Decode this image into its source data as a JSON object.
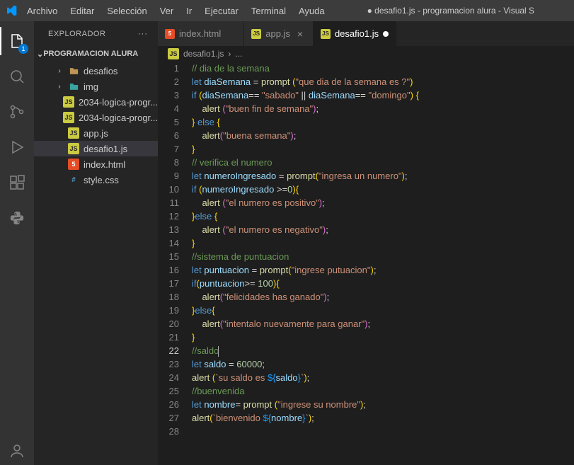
{
  "menu": {
    "archivo": "Archivo",
    "editar": "Editar",
    "seleccion": "Selección",
    "ver": "Ver",
    "ir": "Ir",
    "ejecutar": "Ejecutar",
    "terminal": "Terminal",
    "ayuda": "Ayuda"
  },
  "windowTitle": "● desafio1.js - programacion alura - Visual S",
  "explorer": {
    "label": "EXPLORADOR",
    "section": "PROGRAMACION ALURA"
  },
  "tree": [
    {
      "name": "desafios",
      "icon": "folder",
      "chev": ">"
    },
    {
      "name": "img",
      "icon": "imgfolder",
      "chev": ">"
    },
    {
      "name": "2034-logica-progr...",
      "icon": "js"
    },
    {
      "name": "2034-logica-progr...",
      "icon": "js"
    },
    {
      "name": "app.js",
      "icon": "js"
    },
    {
      "name": "desafio1.js",
      "icon": "js",
      "selected": true
    },
    {
      "name": "index.html",
      "icon": "html"
    },
    {
      "name": "style.css",
      "icon": "css"
    }
  ],
  "tabs": [
    {
      "label": "index.html",
      "icon": "html"
    },
    {
      "label": "app.js",
      "icon": "js",
      "close": true
    },
    {
      "label": "desafio1.js",
      "icon": "js",
      "active": true,
      "dirty": true
    }
  ],
  "breadcrumb": {
    "file": "desafio1.js",
    "rest": "..."
  },
  "code": [
    {
      "n": 1,
      "t": "comment",
      "s": "// dia de la semana"
    },
    {
      "n": 2,
      "s": "<span class='tk-kw'>let</span> <span class='tk-var'>diaSemana</span> = <span class='tk-fn'>prompt</span> <span class='tk-brace-y'>(</span><span class='tk-str'>\"que dia de la semana es ?\"</span><span class='tk-brace-y'>)</span>"
    },
    {
      "n": 3,
      "s": "<span class='tk-kw'>if</span> <span class='tk-brace-y'>(</span><span class='tk-var'>diaSemana</span>== <span class='tk-str'>\"sabado\"</span> || <span class='tk-var'>diaSemana</span>== <span class='tk-str'>\"domingo\"</span><span class='tk-brace-y'>)</span> <span class='tk-brace-y'>{</span>"
    },
    {
      "n": 4,
      "s": "    <span class='tk-fn'>alert</span> <span class='tk-brace-p'>(</span><span class='tk-str'>\"buen fin de semana\"</span><span class='tk-brace-p'>)</span>;"
    },
    {
      "n": 5,
      "s": "<span class='tk-brace-y'>}</span> <span class='tk-kw'>else</span> <span class='tk-brace-y'>{</span>"
    },
    {
      "n": 6,
      "s": "    <span class='tk-fn'>alert</span><span class='tk-brace-p'>(</span><span class='tk-str'>\"buena semana\"</span><span class='tk-brace-p'>)</span>;"
    },
    {
      "n": 7,
      "s": "<span class='tk-brace-y'>}</span>"
    },
    {
      "n": 8,
      "t": "comment",
      "s": "// verifica el numero"
    },
    {
      "n": 9,
      "s": "<span class='tk-kw'>let</span> <span class='tk-var'>numeroIngresado</span> = <span class='tk-fn'>prompt</span><span class='tk-brace-y'>(</span><span class='tk-str'>\"ingresa un numero\"</span><span class='tk-brace-y'>)</span>;"
    },
    {
      "n": 10,
      "s": "<span class='tk-kw'>if</span> <span class='tk-brace-y'>(</span><span class='tk-var'>numeroIngresado</span> &gt;=<span class='tk-num'>0</span><span class='tk-brace-y'>)</span><span class='tk-brace-y'>{</span>"
    },
    {
      "n": 11,
      "s": "    <span class='tk-fn'>alert</span> <span class='tk-brace-p'>(</span><span class='tk-str'>\"el numero es positivo\"</span><span class='tk-brace-p'>)</span>;"
    },
    {
      "n": 12,
      "s": "<span class='tk-brace-y'>}</span><span class='tk-kw'>else</span> <span class='tk-brace-y'>{</span>"
    },
    {
      "n": 13,
      "s": "    <span class='tk-fn'>alert</span> <span class='tk-brace-p'>(</span><span class='tk-str'>\"el numero es negativo\"</span><span class='tk-brace-p'>)</span>;"
    },
    {
      "n": 14,
      "s": "<span class='tk-brace-y'>}</span>"
    },
    {
      "n": 15,
      "t": "comment",
      "s": "//sistema de puntuacion"
    },
    {
      "n": 16,
      "s": "<span class='tk-kw'>let</span> <span class='tk-var'>puntuacion</span> = <span class='tk-fn'>prompt</span><span class='tk-brace-y'>(</span><span class='tk-str'>\"ingrese putuacion\"</span><span class='tk-brace-y'>)</span>;"
    },
    {
      "n": 17,
      "s": "<span class='tk-kw'>if</span><span class='tk-brace-y'>(</span><span class='tk-var'>puntuacion</span>&gt;= <span class='tk-num'>100</span><span class='tk-brace-y'>)</span><span class='tk-brace-y'>{</span>"
    },
    {
      "n": 18,
      "s": "    <span class='tk-fn'>alert</span><span class='tk-brace-p'>(</span><span class='tk-str'>\"felicidades has ganado\"</span><span class='tk-brace-p'>)</span>;"
    },
    {
      "n": 19,
      "s": "<span class='tk-brace-y'>}</span><span class='tk-kw'>else</span><span class='tk-brace-y'>{</span>"
    },
    {
      "n": 20,
      "s": "    <span class='tk-fn'>alert</span><span class='tk-brace-p'>(</span><span class='tk-str'>\"intentalo nuevamente para ganar\"</span><span class='tk-brace-p'>)</span>;"
    },
    {
      "n": 21,
      "s": "<span class='tk-brace-y'>}</span>"
    },
    {
      "n": 22,
      "t": "comment",
      "cursor": true,
      "s": "//saldo"
    },
    {
      "n": 23,
      "s": "<span class='tk-kw'>let</span> <span class='tk-var'>saldo</span> = <span class='tk-num'>60000</span>;"
    },
    {
      "n": 24,
      "s": "<span class='tk-fn'>alert</span> <span class='tk-brace-y'>(</span><span class='tk-str'>`su saldo es </span><span class='tk-brace-b'>${</span><span class='tk-var'>saldo</span><span class='tk-brace-b'>}</span><span class='tk-str'>`</span><span class='tk-brace-y'>)</span>;"
    },
    {
      "n": 25,
      "t": "comment",
      "s": "//buenvenida"
    },
    {
      "n": 26,
      "s": "<span class='tk-kw'>let</span> <span class='tk-var'>nombre</span>= <span class='tk-fn'>prompt</span> <span class='tk-brace-y'>(</span><span class='tk-str'>\"ingrese su nombre\"</span><span class='tk-brace-y'>)</span>;"
    },
    {
      "n": 27,
      "s": "<span class='tk-fn'>alert</span><span class='tk-brace-y'>(</span><span class='tk-str'>`bienvenido </span><span class='tk-brace-b'>${</span><span class='tk-var'>nombre</span><span class='tk-brace-b'>}</span><span class='tk-str'>`</span><span class='tk-brace-y'>)</span>;"
    },
    {
      "n": 28,
      "s": ""
    }
  ]
}
